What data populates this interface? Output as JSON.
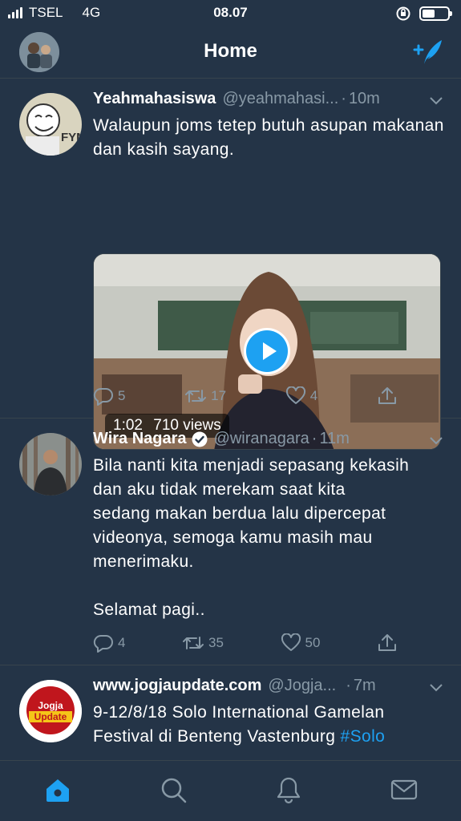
{
  "status_bar": {
    "carrier": "TSEL",
    "network": "4G",
    "time": "08.07",
    "battery_level": 0.5
  },
  "header": {
    "title": "Home"
  },
  "tweets": [
    {
      "name": "Yeahmahasiswa",
      "handle": "@yeahmahasi...",
      "time": "10m",
      "text": "Walaupun joms tetep butuh asupan makanan dan kasih sayang.",
      "video": {
        "duration": "1:02",
        "views": "710 views"
      },
      "replies": "5",
      "retweets": "17",
      "likes": "4",
      "avatar_text": "FYM"
    },
    {
      "name": "Wira Nagara",
      "verified": true,
      "handle": "@wiranagara",
      "time": "11m",
      "text_lines": [
        "Bila nanti kita menjadi sepasang kekasih",
        "dan aku tidak merekam saat kita",
        "sedang makan berdua lalu dipercepat",
        "videonya, semoga kamu masih mau",
        "menerimaku.",
        "",
        "Selamat pagi.."
      ],
      "replies": "4",
      "retweets": "35",
      "likes": "50"
    },
    {
      "name": "www.jogjaupdate.com",
      "handle": "@Jogja...",
      "time": "7m",
      "text_lines": [
        "9-12/8/18 Solo International Gamelan",
        "Festival di Benteng Vastenburg"
      ],
      "hashtag": "#Solo",
      "avatar_text_top": "Jogja",
      "avatar_text_bottom": "Update"
    }
  ],
  "tab_bar": {
    "items": [
      "home-icon",
      "search-icon",
      "notifications-icon",
      "messages-icon"
    ],
    "active": "home-icon"
  },
  "colors": {
    "background": "#243447",
    "accent": "#1da1f2",
    "muted": "#8899a6",
    "divider": "#38444d"
  }
}
